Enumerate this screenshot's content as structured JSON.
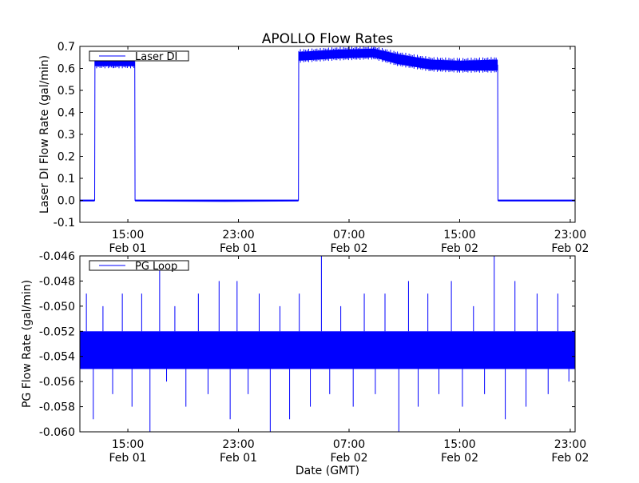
{
  "chart_data": [
    {
      "type": "line",
      "title": "APOLLO Flow Rates",
      "xlabel": "",
      "ylabel": "Laser DI Flow Rate (gal/min)",
      "x_units": "hours since Feb 01 00:00 GMT",
      "xlim": [
        11.53,
        47.35
      ],
      "ylim": [
        -0.1,
        0.7
      ],
      "yticks": [
        -0.1,
        0.0,
        0.1,
        0.2,
        0.3,
        0.4,
        0.5,
        0.6,
        0.7
      ],
      "ytick_labels": [
        "-0.1",
        "0.0",
        "0.1",
        "0.2",
        "0.3",
        "0.4",
        "0.5",
        "0.6",
        "0.7"
      ],
      "xticks": [
        15,
        23,
        31,
        39,
        47
      ],
      "xtick_labels": [
        [
          "15:00",
          "Feb 01"
        ],
        [
          "23:00",
          "Feb 01"
        ],
        [
          "07:00",
          "Feb 02"
        ],
        [
          "15:00",
          "Feb 02"
        ],
        [
          "23:00",
          "Feb 02"
        ]
      ],
      "legend": {
        "entries": [
          "Laser DI"
        ],
        "placement": "top-left"
      },
      "color": "#0000ff",
      "series": [
        {
          "name": "Laser DI",
          "points_t_mean_lo_hi": [
            [
              11.53,
              0.0,
              -0.005,
              0.003
            ],
            [
              12.6,
              0.0,
              -0.005,
              0.003
            ],
            [
              12.62,
              0.63,
              0.61,
              0.65
            ],
            [
              14.0,
              0.63,
              0.61,
              0.65
            ],
            [
              15.5,
              0.63,
              0.61,
              0.65
            ],
            [
              15.52,
              0.0,
              -0.005,
              0.003
            ],
            [
              22.0,
              -0.002,
              -0.007,
              0.003
            ],
            [
              27.34,
              0.0,
              -0.005,
              0.003
            ],
            [
              27.36,
              0.655,
              0.635,
              0.675
            ],
            [
              30.0,
              0.665,
              0.645,
              0.685
            ],
            [
              32.8,
              0.67,
              0.65,
              0.69
            ],
            [
              34.5,
              0.645,
              0.62,
              0.665
            ],
            [
              36.9,
              0.62,
              0.595,
              0.64
            ],
            [
              39.0,
              0.615,
              0.59,
              0.635
            ],
            [
              41.75,
              0.615,
              0.59,
              0.64
            ],
            [
              41.77,
              0.0,
              -0.005,
              0.003
            ],
            [
              47.35,
              0.0,
              -0.005,
              0.003
            ]
          ]
        }
      ]
    },
    {
      "type": "line",
      "title": "",
      "xlabel": "Date (GMT)",
      "ylabel": "PG Flow Rate (gal/min)",
      "x_units": "hours since Feb 01 00:00 GMT",
      "xlim": [
        11.53,
        47.35
      ],
      "ylim": [
        -0.06,
        -0.046
      ],
      "yticks": [
        -0.06,
        -0.058,
        -0.056,
        -0.054,
        -0.052,
        -0.05,
        -0.048,
        -0.046
      ],
      "ytick_labels": [
        "-0.060",
        "-0.058",
        "-0.056",
        "-0.054",
        "-0.052",
        "-0.050",
        "-0.048",
        "-0.046"
      ],
      "xticks": [
        15,
        23,
        31,
        39,
        47
      ],
      "xtick_labels": [
        [
          "15:00",
          "Feb 01"
        ],
        [
          "23:00",
          "Feb 01"
        ],
        [
          "07:00",
          "Feb 02"
        ],
        [
          "15:00",
          "Feb 02"
        ],
        [
          "23:00",
          "Feb 02"
        ]
      ],
      "legend": {
        "entries": [
          "PG Loop"
        ],
        "placement": "top-left"
      },
      "color": "#0000ff",
      "series": [
        {
          "name": "PG Loop",
          "band": [
            -0.055,
            -0.052
          ],
          "spikes_t_value": [
            [
              12.0,
              -0.049
            ],
            [
              12.5,
              -0.059
            ],
            [
              13.2,
              -0.05
            ],
            [
              13.9,
              -0.057
            ],
            [
              14.6,
              -0.049
            ],
            [
              15.3,
              -0.058
            ],
            [
              16.0,
              -0.049
            ],
            [
              16.6,
              -0.06
            ],
            [
              17.3,
              -0.047
            ],
            [
              17.8,
              -0.056
            ],
            [
              18.4,
              -0.05
            ],
            [
              19.2,
              -0.058
            ],
            [
              20.1,
              -0.049
            ],
            [
              20.8,
              -0.057
            ],
            [
              21.6,
              -0.048
            ],
            [
              22.4,
              -0.059
            ],
            [
              22.9,
              -0.048
            ],
            [
              23.7,
              -0.057
            ],
            [
              24.5,
              -0.049
            ],
            [
              25.3,
              -0.06
            ],
            [
              26.0,
              -0.05
            ],
            [
              26.7,
              -0.059
            ],
            [
              27.4,
              -0.049
            ],
            [
              28.2,
              -0.058
            ],
            [
              29.0,
              -0.046
            ],
            [
              29.6,
              -0.057
            ],
            [
              30.4,
              -0.05
            ],
            [
              31.3,
              -0.058
            ],
            [
              32.1,
              -0.049
            ],
            [
              32.9,
              -0.057
            ],
            [
              33.6,
              -0.049
            ],
            [
              34.6,
              -0.06
            ],
            [
              35.3,
              -0.048
            ],
            [
              36.0,
              -0.058
            ],
            [
              36.7,
              -0.049
            ],
            [
              37.5,
              -0.057
            ],
            [
              38.4,
              -0.048
            ],
            [
              39.2,
              -0.058
            ],
            [
              40.0,
              -0.05
            ],
            [
              40.8,
              -0.057
            ],
            [
              41.5,
              -0.046
            ],
            [
              42.3,
              -0.059
            ],
            [
              43.0,
              -0.048
            ],
            [
              43.8,
              -0.058
            ],
            [
              44.6,
              -0.049
            ],
            [
              45.4,
              -0.057
            ],
            [
              46.1,
              -0.049
            ],
            [
              46.9,
              -0.056
            ]
          ]
        }
      ]
    }
  ]
}
